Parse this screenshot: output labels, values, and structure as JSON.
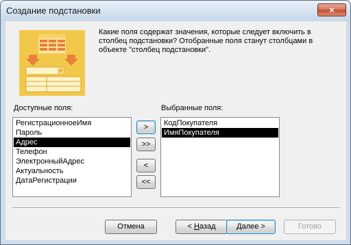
{
  "window": {
    "title": "Создание подстановки",
    "close_glyph": "×"
  },
  "description": "Какие поля содержат значения, которые следует включить в\nстолбец подстановки? Отобранные поля станут столбцами в\nобъекте \"столбец подстановки\".",
  "available": {
    "label": "Доступные поля:",
    "items": [
      "РегистрационноеИмя",
      "Пароль",
      "Адрес",
      "Телефон",
      "ЭлектронныйАдрес",
      "Актуальность",
      "ДатаРегистрации"
    ],
    "selected_index": 2
  },
  "selected": {
    "label": "Выбранные поля:",
    "items": [
      "КодПокупателя",
      "ИмяПокупателя"
    ],
    "selected_index": 1
  },
  "move_buttons": {
    "add": ">",
    "add_all": ">>",
    "remove": "<",
    "remove_all": "<<"
  },
  "buttons": {
    "cancel": "Отмена",
    "back_key": "Н",
    "back_rest": "азад",
    "back_prefix": "< ",
    "next_key": "Д",
    "next_rest": "алее",
    "next_suffix": " >",
    "done": "Готово"
  },
  "colors": {
    "illustration": "#f2c84b",
    "selection": "#000000"
  }
}
